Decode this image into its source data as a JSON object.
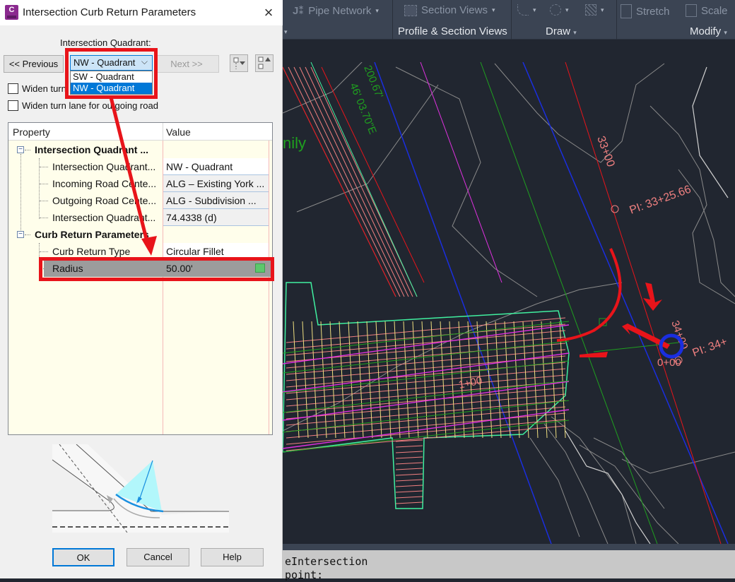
{
  "dialog": {
    "title": "Intersection Curb Return Parameters",
    "app_icon_letter": "C",
    "quadrant_label": "Intersection Quadrant:",
    "prev_label": "<< Previous",
    "next_label": "Next >>",
    "quadrant_select": {
      "value": "NW - Quadrant",
      "options": [
        "SW - Quadrant",
        "NW - Quadrant"
      ],
      "highlighted": "NW - Quadrant"
    },
    "checkboxes": [
      {
        "label": "Widen turn lane for incoming road",
        "visible_label": "Widen turn",
        "label_tail": "d",
        "checked": false
      },
      {
        "label": "Widen turn lane for outgoing road",
        "checked": false
      }
    ],
    "grid": {
      "headers": {
        "property": "Property",
        "value": "Value"
      },
      "categories": [
        {
          "name": "Intersection Quadrant ...",
          "expanded": true,
          "rows": [
            {
              "property": "Intersection Quadrant...",
              "value": "NW - Quadrant"
            },
            {
              "property": "Incoming Road Cente...",
              "value": "ALG – Existing York ..."
            },
            {
              "property": "Outgoing Road Cente...",
              "value": "ALG - Subdivision ..."
            },
            {
              "property": "Intersection Quadrant...",
              "value": "74.4338 (d)"
            }
          ]
        },
        {
          "name": "Curb Return Parameters",
          "expanded": true,
          "rows": [
            {
              "property": "Curb Return Type",
              "value": "Circular Fillet"
            },
            {
              "property": "Radius",
              "value": "50.00'",
              "selected": true
            }
          ]
        }
      ]
    },
    "buttons": {
      "ok": "OK",
      "cancel": "Cancel",
      "help": "Help"
    },
    "icons": {
      "close": "×",
      "chevron": "⌵"
    }
  },
  "ribbon": {
    "tools": [
      {
        "label": "Pipe Network",
        "icon": "pipe-network-icon"
      },
      {
        "label": "Section Views",
        "icon": "section-views-icon"
      },
      {
        "label": "Stretch",
        "icon": "stretch-icon"
      },
      {
        "label": "Scale",
        "icon": "scale-icon"
      }
    ],
    "panels": [
      "Profile & Section Views",
      "Draw",
      "Modify"
    ],
    "caret": "▾"
  },
  "drawing": {
    "labels": {
      "station_33": "33+00",
      "pi_1": "PI: 33+25.66",
      "pi_2": "PI: 34+",
      "station_34": "34+00",
      "station_0": "0+00",
      "station_1": "1+00",
      "bearing": "46' 03.70\"E",
      "distance": "200.67'",
      "partial_text": "nily"
    },
    "colors": {
      "background": "#212630",
      "alignment_red": "#e8141a",
      "alignment_blue": "#1a2ee0",
      "green": "#1fa01f",
      "magenta": "#e030e0",
      "salmon": "#f08080",
      "yellow": "#f0e080",
      "cyan_green": "#40f0a0",
      "contour": "#9a9a9a"
    }
  },
  "command_line": {
    "lines": [
      "eIntersection",
      "point:"
    ]
  },
  "annotations": {
    "highlight_color": "#e8141a"
  }
}
